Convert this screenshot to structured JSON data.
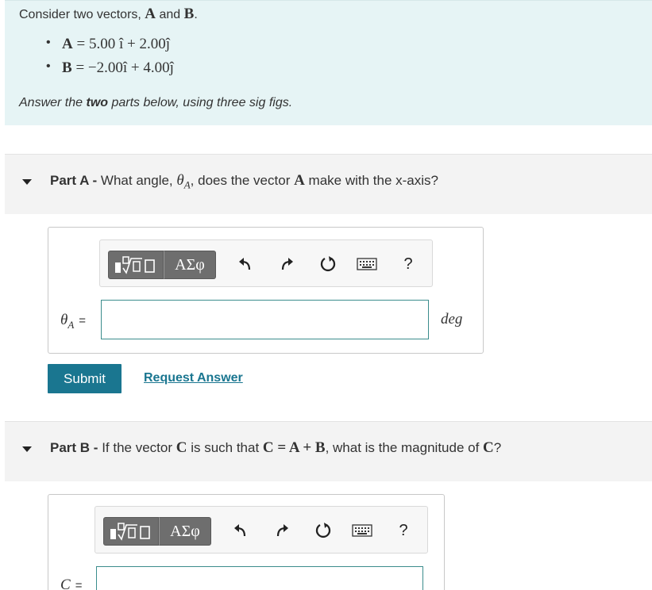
{
  "intro": {
    "lead": "Consider two vectors,",
    "vecA": "A",
    "and": "and",
    "vecB": "B",
    "period": ".",
    "bullets": [
      {
        "vec": "A",
        "expr": " = 5.00 î  + 2.00ĵ"
      },
      {
        "vec": "B",
        "expr": " = −2.00î  + 4.00ĵ"
      }
    ],
    "instr_pre": "Answer the ",
    "instr_bold": "two",
    "instr_post": " parts below, using three sig figs."
  },
  "partA": {
    "label": "Part A -",
    "q_pre": " What angle, ",
    "q_sym": "θ",
    "q_sub": "A",
    "q_mid": ", does the vector ",
    "q_vec": "A",
    "q_post": " make with the x-axis?",
    "var": "θ",
    "var_sub": "A",
    "eq": "=",
    "input_value": "",
    "unit": "deg",
    "submit": "Submit",
    "request": "Request Answer"
  },
  "partB": {
    "label": "Part B -",
    "q_pre": " If the vector ",
    "q_vec": "C",
    "q_mid": " is such that ",
    "q_eqn": "C = A + B",
    "q_mid2": ", what is the magnitude of ",
    "q_vec2": "C",
    "q_post": "?",
    "var": "C",
    "eq": "="
  },
  "toolbar": {
    "greek": "ΑΣφ",
    "help": "?",
    "icons": [
      "templates-icon",
      "greek-symbols-icon",
      "undo-icon",
      "redo-icon",
      "reset-icon",
      "keyboard-icon",
      "help-icon"
    ]
  }
}
